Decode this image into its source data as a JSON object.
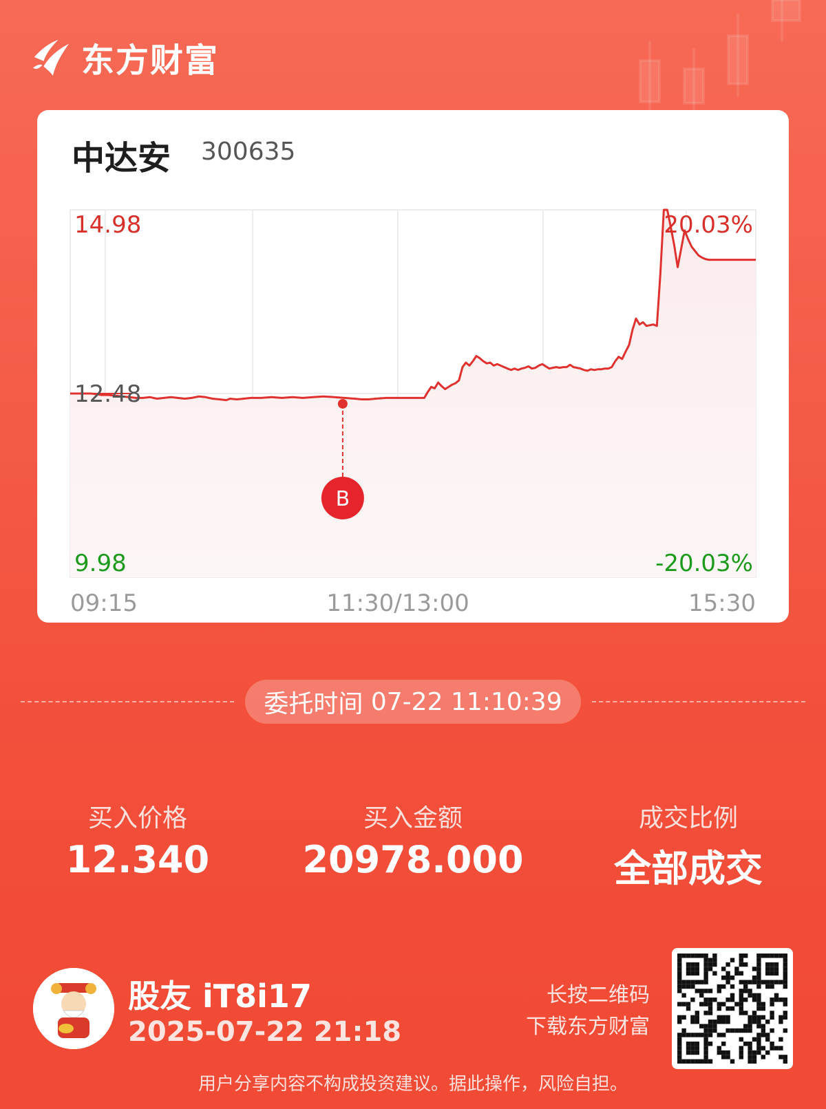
{
  "brand": {
    "name": "东方财富",
    "logo_icon": "eastmoney-logo-icon"
  },
  "stock": {
    "name": "中达安",
    "code": "300635"
  },
  "chart_data": {
    "type": "line",
    "price_labels": {
      "top": "14.98",
      "mid": "12.48",
      "bottom": "9.98"
    },
    "pct_labels": {
      "top": "20.03%",
      "bottom": "-20.03%"
    },
    "x_ticks": [
      "09:15",
      "11:30/13:00",
      "15:30"
    ],
    "ylim": [
      9.98,
      14.98
    ],
    "reference_price": 12.48,
    "series": [
      {
        "values": [
          [
            0,
            12.48
          ],
          [
            6,
            12.48
          ],
          [
            12,
            12.48
          ],
          [
            16,
            12.47
          ],
          [
            18,
            12.46
          ],
          [
            22,
            12.46
          ],
          [
            26,
            12.45
          ],
          [
            30,
            12.44
          ],
          [
            34,
            12.43
          ],
          [
            38,
            12.42
          ],
          [
            42,
            12.42
          ],
          [
            46,
            12.43
          ],
          [
            50,
            12.41
          ],
          [
            54,
            12.42
          ],
          [
            58,
            12.43
          ],
          [
            62,
            12.42
          ],
          [
            66,
            12.41
          ],
          [
            70,
            12.42
          ],
          [
            74,
            12.44
          ],
          [
            78,
            12.43
          ],
          [
            82,
            12.41
          ],
          [
            86,
            12.4
          ],
          [
            90,
            12.39
          ],
          [
            92,
            12.41
          ],
          [
            96,
            12.4
          ],
          [
            100,
            12.41
          ],
          [
            104,
            12.42
          ],
          [
            110,
            12.42
          ],
          [
            116,
            12.43
          ],
          [
            122,
            12.42
          ],
          [
            128,
            12.43
          ],
          [
            134,
            12.42
          ],
          [
            140,
            12.43
          ],
          [
            146,
            12.44
          ],
          [
            152,
            12.43
          ],
          [
            158,
            12.42
          ],
          [
            164,
            12.41
          ],
          [
            168,
            12.4
          ],
          [
            172,
            12.4
          ],
          [
            176,
            12.41
          ],
          [
            182,
            12.42
          ],
          [
            188,
            12.42
          ],
          [
            194,
            12.42
          ],
          [
            200,
            12.42
          ],
          [
            204,
            12.42
          ],
          [
            206,
            12.5
          ],
          [
            208,
            12.57
          ],
          [
            210,
            12.55
          ],
          [
            212,
            12.63
          ],
          [
            214,
            12.58
          ],
          [
            216,
            12.54
          ],
          [
            218,
            12.57
          ],
          [
            220,
            12.6
          ],
          [
            222,
            12.62
          ],
          [
            224,
            12.66
          ],
          [
            226,
            12.84
          ],
          [
            228,
            12.9
          ],
          [
            230,
            12.86
          ],
          [
            232,
            12.92
          ],
          [
            234,
            12.99
          ],
          [
            236,
            12.96
          ],
          [
            238,
            12.92
          ],
          [
            240,
            12.89
          ],
          [
            242,
            12.9
          ],
          [
            244,
            12.86
          ],
          [
            246,
            12.88
          ],
          [
            248,
            12.86
          ],
          [
            250,
            12.84
          ],
          [
            252,
            12.82
          ],
          [
            254,
            12.8
          ],
          [
            256,
            12.82
          ],
          [
            258,
            12.8
          ],
          [
            260,
            12.82
          ],
          [
            262,
            12.83
          ],
          [
            264,
            12.85
          ],
          [
            266,
            12.82
          ],
          [
            268,
            12.83
          ],
          [
            270,
            12.86
          ],
          [
            272,
            12.88
          ],
          [
            274,
            12.85
          ],
          [
            276,
            12.82
          ],
          [
            278,
            12.83
          ],
          [
            280,
            12.84
          ],
          [
            282,
            12.83
          ],
          [
            284,
            12.84
          ],
          [
            286,
            12.84
          ],
          [
            288,
            12.87
          ],
          [
            290,
            12.84
          ],
          [
            292,
            12.83
          ],
          [
            294,
            12.82
          ],
          [
            296,
            12.8
          ],
          [
            298,
            12.79
          ],
          [
            300,
            12.81
          ],
          [
            302,
            12.8
          ],
          [
            304,
            12.81
          ],
          [
            306,
            12.81
          ],
          [
            308,
            12.82
          ],
          [
            310,
            12.82
          ],
          [
            312,
            12.84
          ],
          [
            314,
            12.92
          ],
          [
            316,
            12.98
          ],
          [
            318,
            12.95
          ],
          [
            320,
            13.05
          ],
          [
            322,
            13.14
          ],
          [
            324,
            13.35
          ],
          [
            326,
            13.5
          ],
          [
            328,
            13.42
          ],
          [
            330,
            13.45
          ],
          [
            332,
            13.4
          ],
          [
            334,
            13.41
          ],
          [
            336,
            13.42
          ],
          [
            338,
            13.4
          ],
          [
            340,
            14.1
          ],
          [
            342,
            14.98
          ],
          [
            344,
            14.98
          ],
          [
            346,
            14.75
          ],
          [
            348,
            14.5
          ],
          [
            350,
            14.2
          ],
          [
            352,
            14.45
          ],
          [
            354,
            14.7
          ],
          [
            356,
            14.58
          ],
          [
            358,
            14.48
          ],
          [
            360,
            14.42
          ],
          [
            362,
            14.36
          ],
          [
            364,
            14.33
          ],
          [
            366,
            14.31
          ],
          [
            368,
            14.3
          ],
          [
            375,
            14.3
          ],
          [
            385,
            14.3
          ],
          [
            395,
            14.3
          ]
        ]
      }
    ],
    "markers": [
      {
        "type": "buy",
        "label": "B",
        "x": 157,
        "price": 12.34
      }
    ]
  },
  "order": {
    "time_label": "委托时间",
    "time_value": "07-22 11:10:39"
  },
  "stats": [
    {
      "label": "买入价格",
      "value": "12.340"
    },
    {
      "label": "买入金额",
      "value": "20978.000"
    },
    {
      "label": "成交比例",
      "value": "全部成交"
    }
  ],
  "user": {
    "name": "股友 iT8i17",
    "time": "2025-07-22 21:18",
    "avatar_icon": "god-of-wealth-avatar"
  },
  "qr": {
    "hint_line1": "长按二维码",
    "hint_line2": "下载东方财富"
  },
  "disclaimer": "用户分享内容不构成投资建议。据此操作，风险自担。",
  "colors": {
    "up": "#e02a2a",
    "down": "#1c9a1c",
    "line": "#e0312f",
    "background_top": "#f76a55",
    "background_bottom": "#f14a35"
  }
}
